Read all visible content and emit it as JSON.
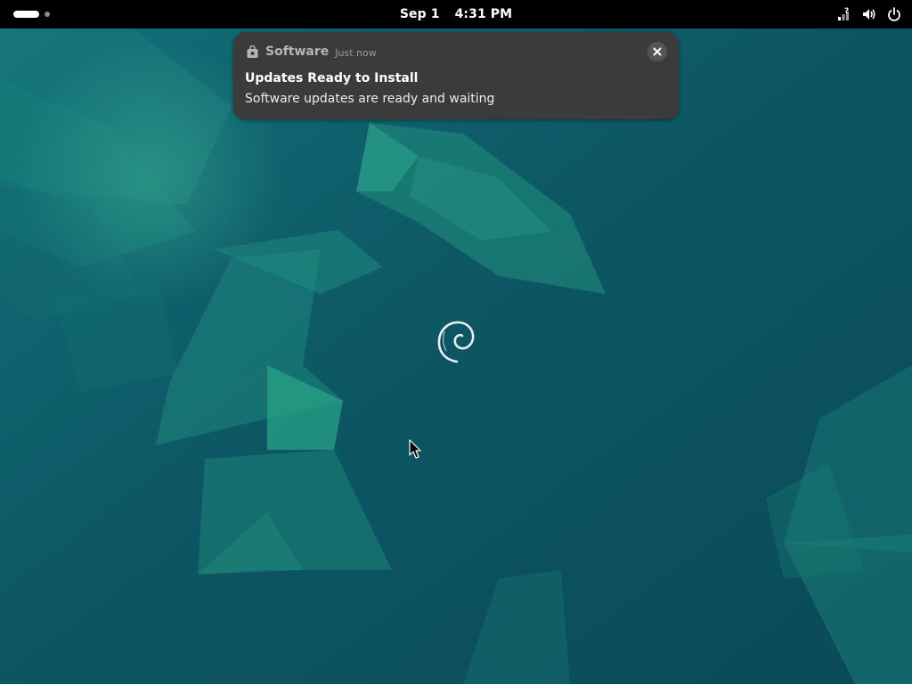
{
  "topbar": {
    "date": "Sep 1",
    "time": "4:31 PM",
    "icons": [
      "activities-workspace-indicator",
      "network-unknown-icon",
      "volume-icon",
      "power-icon"
    ]
  },
  "notification": {
    "app_name": "Software",
    "timestamp": "Just now",
    "title": "Updates Ready to Install",
    "body": "Software updates are ready and waiting",
    "app_icon": "software-bag-icon",
    "close_icon": "close-icon"
  },
  "desktop": {
    "logo": "debian-swirl-logo",
    "background_color": "#0c4f5c",
    "accent_colors": [
      "#1d8a78",
      "#2aa084",
      "#0e5e66"
    ]
  }
}
